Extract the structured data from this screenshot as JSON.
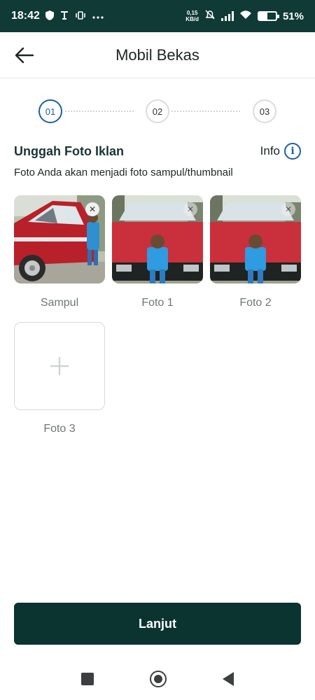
{
  "status_bar": {
    "time": "18:42",
    "net_speed_value": "0,15",
    "net_speed_unit": "KB/d",
    "battery_level": 0.51,
    "battery_text": "51%",
    "icons": [
      "shield-icon",
      "nfc-icon",
      "vibrate-icon",
      "more-dots-icon",
      "mute-bell-icon",
      "signal-icon",
      "wifi-icon",
      "battery-icon"
    ]
  },
  "header": {
    "title": "Mobil Bekas",
    "back_icon": "arrow-left-icon"
  },
  "stepper": {
    "steps": [
      "01",
      "02",
      "03"
    ],
    "active_index": 0
  },
  "upload": {
    "title": "Unggah Foto Iklan",
    "info_label": "Info",
    "subtitle": "Foto Anda akan menjadi foto sampul/thumbnail",
    "photos": [
      {
        "label": "Sampul"
      },
      {
        "label": "Foto 1"
      },
      {
        "label": "Foto 2"
      }
    ],
    "add_slot_label": "Foto 3"
  },
  "footer": {
    "next_label": "Lanjut"
  },
  "colors": {
    "primary_dark": "#0b3431",
    "status_bar": "#0f3a35",
    "accent_blue": "#1a5fa8"
  }
}
